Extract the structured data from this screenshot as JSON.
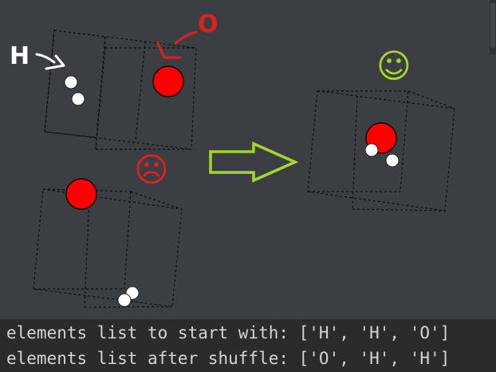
{
  "annotations": {
    "hydrogen_label": "H",
    "oxygen_label": "O",
    "sad_face": "☹",
    "happy_face": "☺"
  },
  "colors": {
    "background": "#3b3f43",
    "console_background": "#2b2b2b",
    "console_text": "#d4d4d4",
    "oxygen": "#ff0000",
    "hydrogen": "#ffffff",
    "annotation_red": "#e02020",
    "annotation_white": "#ffffff",
    "annotation_green": "#a6d627"
  },
  "icons": {
    "sad": "sad-face-icon",
    "happy": "happy-face-icon",
    "arrow": "right-arrow-icon"
  },
  "console": {
    "lines": [
      "elements list to start with: ['H', 'H', 'O']",
      "elements list after shuffle: ['O', 'H', 'H']"
    ]
  }
}
